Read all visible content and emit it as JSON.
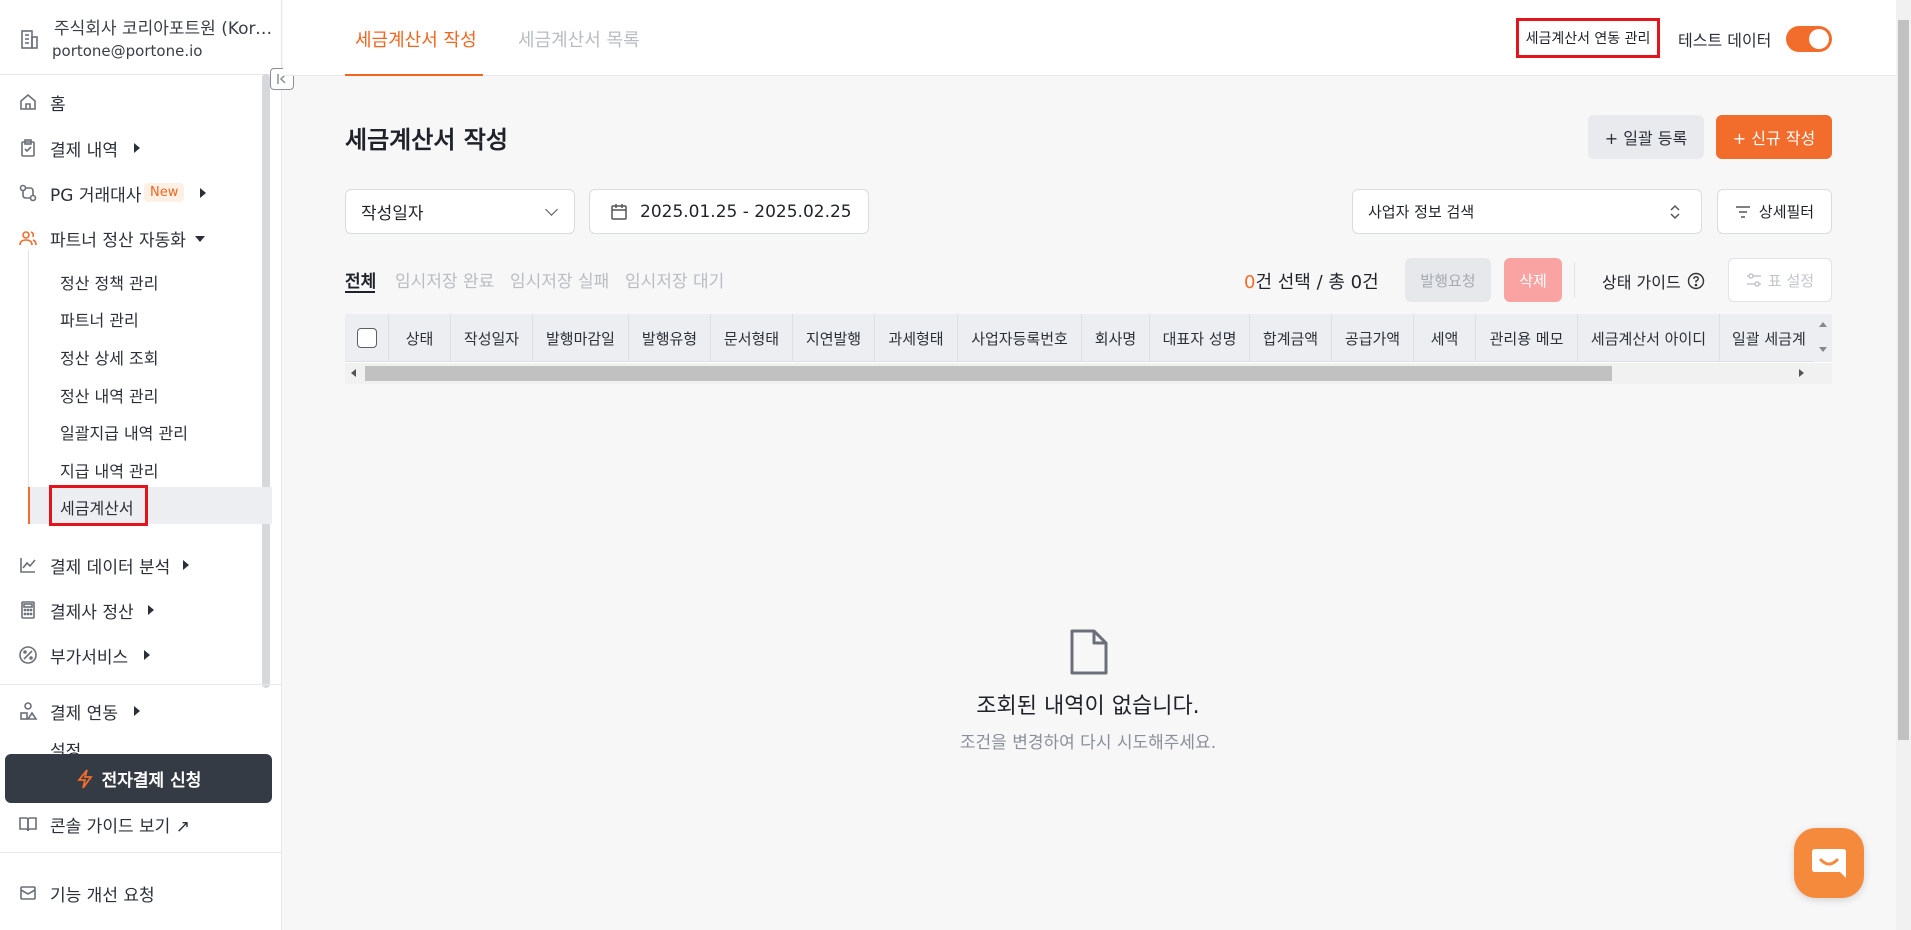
{
  "sidebar": {
    "org_name": "주식회사 코리아포트원 (Kore...",
    "org_email": "portone@portone.io",
    "items": [
      {
        "label": "홈",
        "icon": "home-icon"
      },
      {
        "label": "결제 내역",
        "icon": "clipboard-check-icon"
      },
      {
        "label": "PG 거래대사",
        "icon": "reconcile-icon",
        "badge": "New"
      },
      {
        "label": "파트너 정산 자동화",
        "icon": "users-icon"
      }
    ],
    "sub_items": [
      {
        "label": "정산 정책 관리"
      },
      {
        "label": "파트너 관리"
      },
      {
        "label": "정산 상세 조회"
      },
      {
        "label": "정산 내역 관리"
      },
      {
        "label": "일괄지급 내역 관리"
      },
      {
        "label": "지급 내역 관리"
      },
      {
        "label": "세금계산서"
      }
    ],
    "items2": [
      {
        "label": "결제 데이터 분석",
        "icon": "chart-line-icon"
      },
      {
        "label": "결제사 정산",
        "icon": "calculator-icon"
      },
      {
        "label": "부가서비스",
        "icon": "percent-icon"
      },
      {
        "label": "결제 연동",
        "icon": "shapes-icon"
      },
      {
        "label": "설정",
        "icon": "settings-icon"
      }
    ],
    "apply_button": "전자결제 신청",
    "console_guide": "콘솔 가이드 보기 ↗",
    "feature_request": "기능 개선 요청"
  },
  "header": {
    "tabs": [
      {
        "label": "세금계산서 작성",
        "active": true
      },
      {
        "label": "세금계산서 목록",
        "active": false
      }
    ],
    "link_manage": "세금계산서 연동 관리",
    "test_data_label": "테스트 데이터",
    "test_data_on": true
  },
  "main": {
    "title": "세금계산서 작성",
    "bulk_button": "+ 일괄 등록",
    "new_button": "+ 신규 작성",
    "date_type": "작성일자",
    "date_range": "2025.01.25 - 2025.02.25",
    "business_search": "사업자 정보 검색",
    "detail_filter": "상세필터",
    "filter_tabs": [
      "전체",
      "임시저장 완료",
      "임시저장 실패",
      "임시저장 대기"
    ],
    "selected_count": "0",
    "count_text": "건 선택 / 총 0건",
    "issue_request": "발행요청",
    "delete": "삭제",
    "status_guide": "상태 가이드",
    "table_setting": "표 설정",
    "columns": [
      "상태",
      "작성일자",
      "발행마감일",
      "발행유형",
      "문서형태",
      "지연발행",
      "과세형태",
      "사업자등록번호",
      "회사명",
      "대표자 성명",
      "합계금액",
      "공급가액",
      "세액",
      "관리용 메모",
      "세금계산서 아이디",
      "일괄 세금계"
    ],
    "empty_title": "조회된 내역이 없습니다.",
    "empty_subtitle": "조건을 변경하여 다시 시도해주세요."
  },
  "colors": {
    "accent": "#f26c2b",
    "highlight_box": "#e3141b",
    "dark_button": "#353b45"
  }
}
